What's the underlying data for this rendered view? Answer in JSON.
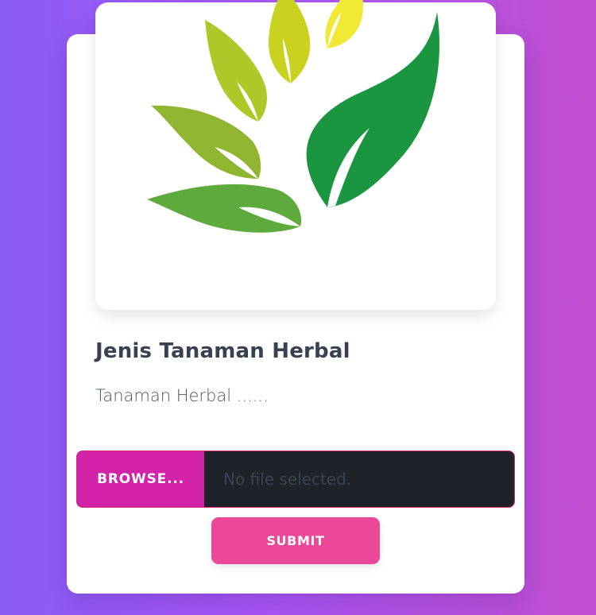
{
  "card": {
    "title": "Jenis Tanaman Herbal",
    "description": "Tanaman Herbal ......"
  },
  "image": {
    "icon": "herbal-leaves-logo",
    "colors": [
      "#1a9641",
      "#5faa3c",
      "#8fb531",
      "#aec82a",
      "#c8d21f",
      "#f2e935"
    ]
  },
  "upload": {
    "browse_label": "BROWSE...",
    "status_text": "No file selected."
  },
  "actions": {
    "submit_label": "SUBMIT"
  },
  "colors": {
    "background_start": "#8b5cf6",
    "background_end": "#c14ecf",
    "browse": "#d324a9",
    "submit": "#ec4899",
    "file_field": "#1f2329"
  }
}
